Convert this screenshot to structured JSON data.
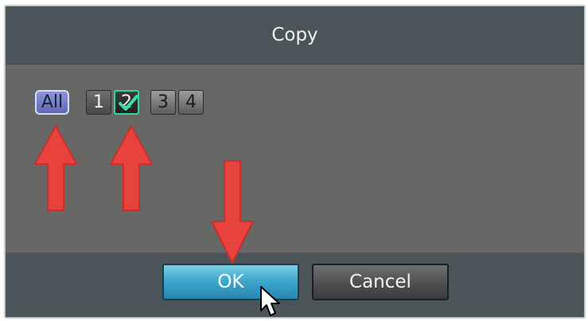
{
  "dialog": {
    "title": "Copy",
    "channels": {
      "all_label": "All",
      "items": [
        {
          "label": "1",
          "selected": false
        },
        {
          "label": "2",
          "selected": true
        },
        {
          "label": "3",
          "selected": false
        },
        {
          "label": "4",
          "selected": false
        }
      ]
    },
    "buttons": {
      "ok_label": "OK",
      "cancel_label": "Cancel"
    }
  },
  "colors": {
    "title_bar": "#4a5459",
    "content_bg": "#676866",
    "all_selected": "#6b74c4",
    "checked_border": "#2fd59a",
    "ok_button": "#3fa9ce",
    "annotation_arrow": "#e8423d"
  },
  "icons": {
    "checkmark": "check-icon",
    "annotation": "red-arrow-icon",
    "pointer": "mouse-cursor-icon"
  }
}
